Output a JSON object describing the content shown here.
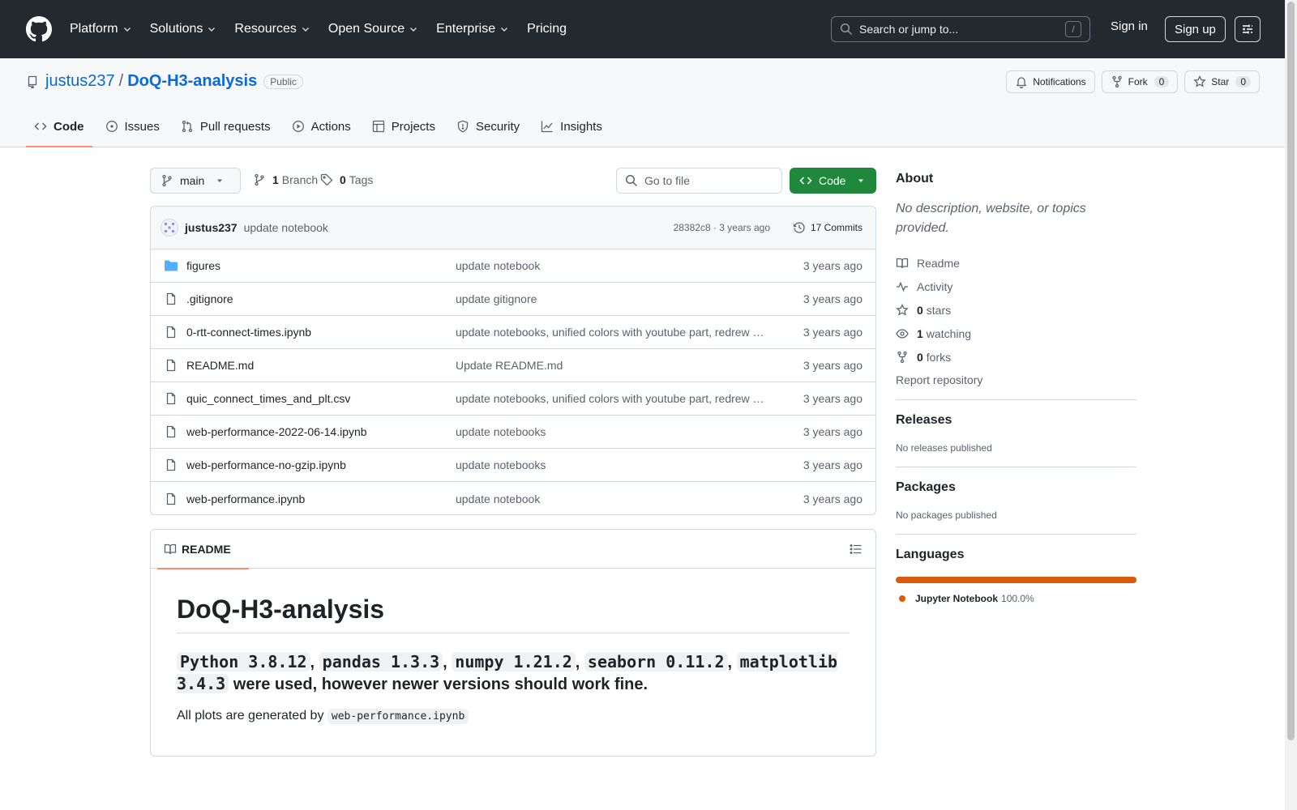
{
  "header": {
    "nav": [
      {
        "label": "Platform",
        "dropdown": true
      },
      {
        "label": "Solutions",
        "dropdown": true
      },
      {
        "label": "Resources",
        "dropdown": true
      },
      {
        "label": "Open Source",
        "dropdown": true
      },
      {
        "label": "Enterprise",
        "dropdown": true
      },
      {
        "label": "Pricing",
        "dropdown": false
      }
    ],
    "search_placeholder": "Search or jump to...",
    "search_shortcut": "/",
    "sign_in": "Sign in",
    "sign_up": "Sign up"
  },
  "repo": {
    "owner": "justus237",
    "separator": "/",
    "name": "DoQ-H3-analysis",
    "visibility": "Public",
    "notifications_label": "Notifications",
    "fork_label": "Fork",
    "fork_count": "0",
    "star_label": "Star",
    "star_count": "0",
    "tabs": [
      {
        "label": "Code",
        "icon": "code-icon",
        "active": true
      },
      {
        "label": "Issues",
        "icon": "issue-icon",
        "active": false
      },
      {
        "label": "Pull requests",
        "icon": "pull-request-icon",
        "active": false
      },
      {
        "label": "Actions",
        "icon": "play-icon",
        "active": false
      },
      {
        "label": "Projects",
        "icon": "table-icon",
        "active": false
      },
      {
        "label": "Security",
        "icon": "shield-icon",
        "active": false
      },
      {
        "label": "Insights",
        "icon": "graph-icon",
        "active": false
      }
    ]
  },
  "toolbar": {
    "branch": "main",
    "branch_count": "1",
    "branch_label": "Branch",
    "tag_count": "0",
    "tag_label": "Tags",
    "go_to_file": "Go to file",
    "code_button": "Code"
  },
  "latest_commit": {
    "author": "justus237",
    "message": "update notebook",
    "meta": "28382c8 · 3 years ago",
    "commits": "17 Commits"
  },
  "files": [
    {
      "name": "figures",
      "type": "folder",
      "commit": "update notebook",
      "age": "3 years ago"
    },
    {
      "name": ".gitignore",
      "type": "file",
      "commit": "update gitignore",
      "age": "3 years ago"
    },
    {
      "name": "0-rtt-connect-times.ipynb",
      "type": "file",
      "commit": "update notebooks, unified colors with youtube part, redrew …",
      "age": "3 years ago"
    },
    {
      "name": "README.md",
      "type": "file",
      "commit": "Update README.md",
      "age": "3 years ago"
    },
    {
      "name": "quic_connect_times_and_plt.csv",
      "type": "file",
      "commit": "update notebooks, unified colors with youtube part, redrew …",
      "age": "3 years ago"
    },
    {
      "name": "web-performance-2022-06-14.ipynb",
      "type": "file",
      "commit": "update notebooks",
      "age": "3 years ago"
    },
    {
      "name": "web-performance-no-gzip.ipynb",
      "type": "file",
      "commit": "update notebooks",
      "age": "3 years ago"
    },
    {
      "name": "web-performance.ipynb",
      "type": "file",
      "commit": "update notebook",
      "age": "3 years ago"
    }
  ],
  "readme": {
    "tab_label": "README",
    "title": "DoQ-H3-analysis",
    "versions": [
      "Python 3.8.12",
      "pandas 1.3.3",
      "numpy 1.21.2",
      "seaborn 0.11.2",
      "matplotlib 3.4.3"
    ],
    "comma": ",",
    "versions_suffix": "were used, however newer versions should work fine.",
    "plots_text": "All plots are generated by",
    "plots_file": "web-performance.ipynb"
  },
  "about": {
    "title": "About",
    "description": "No description, website, or topics provided.",
    "readme": "Readme",
    "activity": "Activity",
    "stars_count": "0",
    "stars_label": "stars",
    "watching_count": "1",
    "watching_label": "watching",
    "forks_count": "0",
    "forks_label": "forks",
    "report": "Report repository"
  },
  "releases": {
    "title": "Releases",
    "empty": "No releases published"
  },
  "packages": {
    "title": "Packages",
    "empty": "No packages published"
  },
  "languages": {
    "title": "Languages",
    "items": [
      {
        "name": "Jupyter Notebook",
        "percent": "100.0%",
        "share": 1.0,
        "color": "#da5b0b"
      }
    ]
  },
  "colors": {
    "header_bg": "#24292f",
    "link": "#0969da",
    "primary_button": "#1f883d",
    "tab_underline": "#fd8c73"
  }
}
